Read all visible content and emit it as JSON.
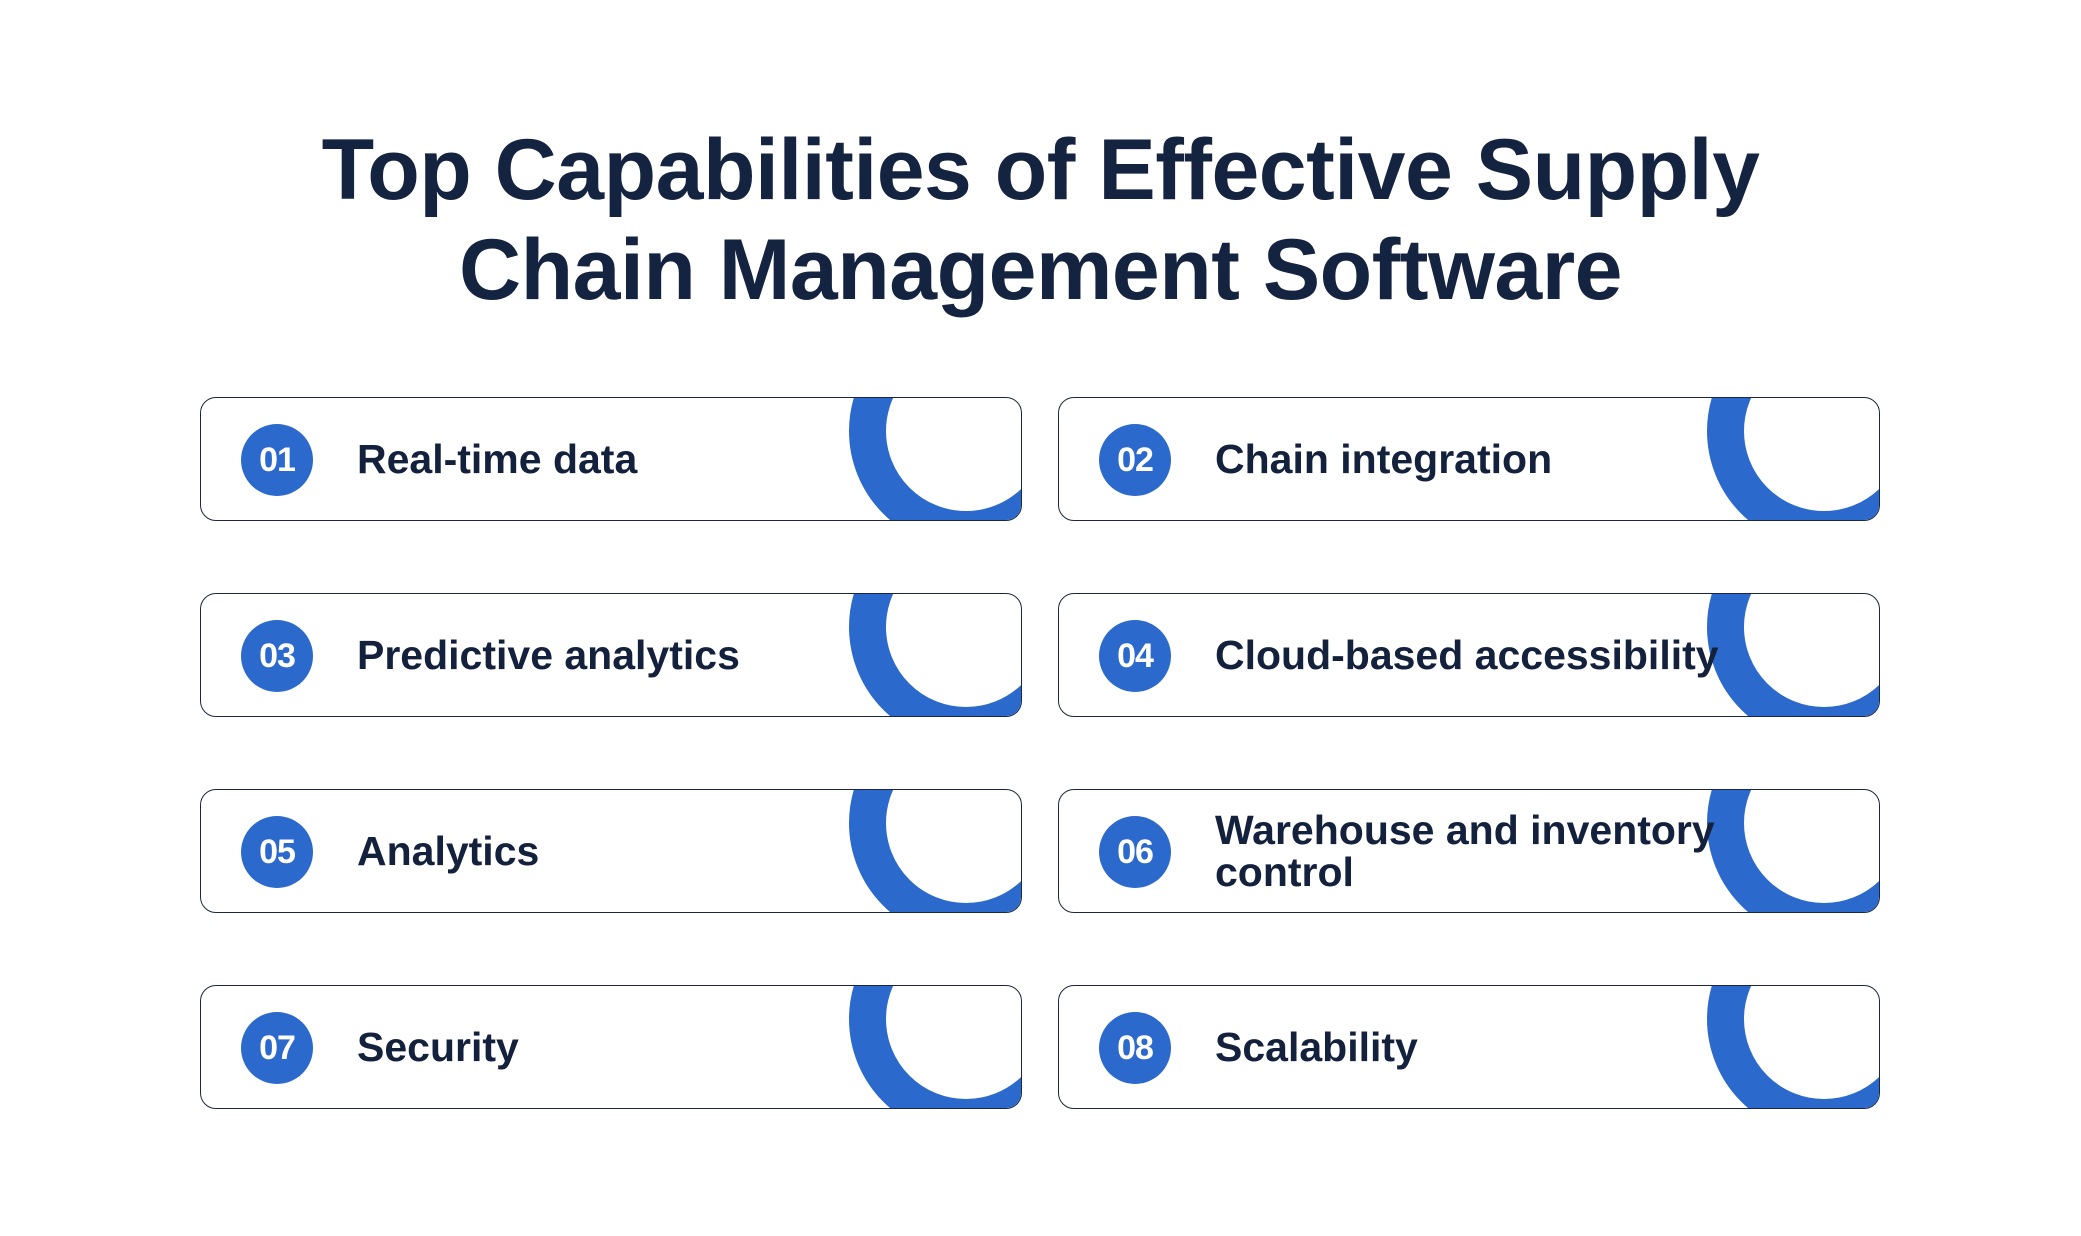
{
  "title": {
    "line1": "Top Capabilities of Effective Supply",
    "line2": "Chain Management Software"
  },
  "accent_color": "#2b69cc",
  "text_color": "#14213d",
  "capabilities": [
    {
      "number": "01",
      "label": "Real-time data"
    },
    {
      "number": "02",
      "label": "Chain integration"
    },
    {
      "number": "03",
      "label": "Predictive analytics"
    },
    {
      "number": "04",
      "label": "Cloud-based accessibility"
    },
    {
      "number": "05",
      "label": "Analytics"
    },
    {
      "number": "06",
      "label": "Warehouse and inventory control"
    },
    {
      "number": "07",
      "label": "Security"
    },
    {
      "number": "08",
      "label": "Scalability"
    }
  ]
}
